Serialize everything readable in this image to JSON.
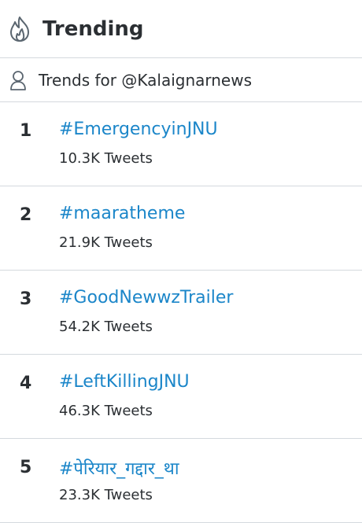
{
  "header": {
    "icon": "flame-icon",
    "title": "Trending"
  },
  "trends_for": {
    "icon": "person-icon",
    "label": "Trends for @Kalaignarnews"
  },
  "trends": [
    {
      "rank": "1",
      "tag": "#EmergencyinJNU",
      "count": "10.3K Tweets"
    },
    {
      "rank": "2",
      "tag": "#maaratheme",
      "count": "21.9K Tweets"
    },
    {
      "rank": "3",
      "tag": "#GoodNewwzTrailer",
      "count": "54.2K Tweets"
    },
    {
      "rank": "4",
      "tag": "#LeftKillingJNU",
      "count": "46.3K Tweets"
    },
    {
      "rank": "5",
      "tag": "#पेरियार_गद्दार_था",
      "count": "23.3K Tweets"
    }
  ],
  "colors": {
    "link": "#1b86c9",
    "text": "#2b2f33",
    "divider": "#d4d9de"
  }
}
